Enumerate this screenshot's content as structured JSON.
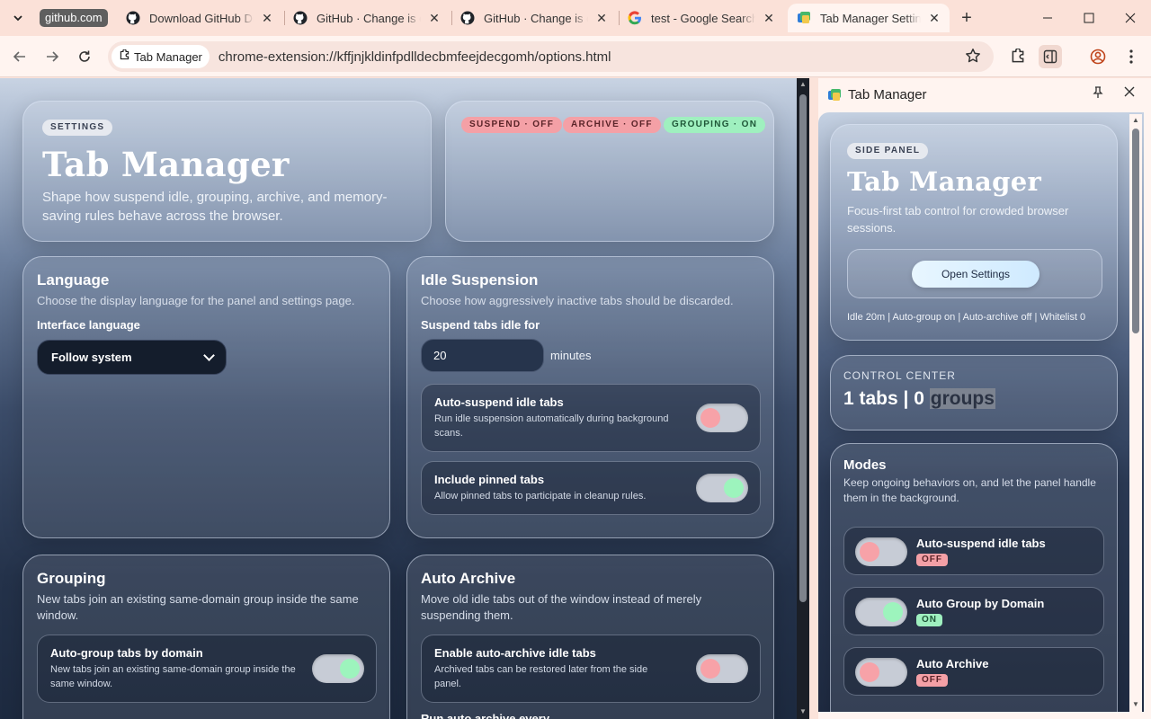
{
  "browser": {
    "tab_group": "github.com",
    "tabs": [
      {
        "title": "Download GitHub Desktop",
        "icon": "github-icon"
      },
      {
        "title": "GitHub · Change is constant",
        "icon": "github-icon"
      },
      {
        "title": "GitHub · Change is constant",
        "icon": "github-icon"
      },
      {
        "title": "test - Google Search",
        "icon": "google-icon"
      },
      {
        "title": "Tab Manager Settings",
        "icon": "tab-manager-icon",
        "active": true
      }
    ],
    "omnibox": {
      "site_chip": "Tab Manager",
      "url": "chrome-extension://kffjnjkldinfpdlldecbmfeejdecgomh/options.html"
    }
  },
  "settings": {
    "hero": {
      "badge": "SETTINGS",
      "title": "Tab Manager",
      "description": "Shape how suspend idle, grouping, archive, and memory-saving rules behave across the browser."
    },
    "status_pills": [
      "SUSPEND · OFF",
      "ARCHIVE · OFF",
      "GROUPING · ON"
    ],
    "language": {
      "title": "Language",
      "description": "Choose the display language for the panel and settings page.",
      "field_label": "Interface language",
      "selected": "Follow system"
    },
    "idle": {
      "title": "Idle Suspension",
      "description": "Choose how aggressively inactive tabs should be discarded.",
      "field_label": "Suspend tabs idle for",
      "value": "20",
      "unit": "minutes",
      "options": [
        {
          "title": "Auto-suspend idle tabs",
          "description": "Run idle suspension automatically during background scans.",
          "enabled": false
        },
        {
          "title": "Include pinned tabs",
          "description": "Allow pinned tabs to participate in cleanup rules.",
          "enabled": true
        }
      ]
    },
    "grouping": {
      "title": "Grouping",
      "description": "New tabs join an existing same-domain group inside the same window.",
      "option": {
        "title": "Auto-group tabs by domain",
        "description": "New tabs join an existing same-domain group inside the same window.",
        "enabled": true
      }
    },
    "archive": {
      "title": "Auto Archive",
      "description": "Move old idle tabs out of the window instead of merely suspending them.",
      "option": {
        "title": "Enable auto-archive idle tabs",
        "description": "Archived tabs can be restored later from the side panel.",
        "enabled": false
      },
      "next_label": "Run auto archive every"
    }
  },
  "side_panel": {
    "header_title": "Tab Manager",
    "hero": {
      "badge": "SIDE PANEL",
      "title": "Tab Manager",
      "description": "Focus-first tab control for crowded browser sessions.",
      "button": "Open Settings",
      "summary": "Idle 20m | Auto-group on | Auto-archive off | Whitelist 0"
    },
    "control_center": {
      "label": "CONTROL CENTER",
      "stats_prefix": "1 tabs | 0 ",
      "stats_highlight": "groups"
    },
    "modes": {
      "title": "Modes",
      "description": "Keep ongoing behaviors on, and let the panel handle them in the background.",
      "items": [
        {
          "title": "Auto-suspend idle tabs",
          "status": "OFF"
        },
        {
          "title": "Auto Group by Domain",
          "status": "ON"
        },
        {
          "title": "Auto Archive",
          "status": "OFF"
        }
      ]
    }
  },
  "colors": {
    "toggle_on_knob": "#9df4bd",
    "toggle_off_knob": "#f7a2a8",
    "chrome_background": "#fbe3da"
  }
}
